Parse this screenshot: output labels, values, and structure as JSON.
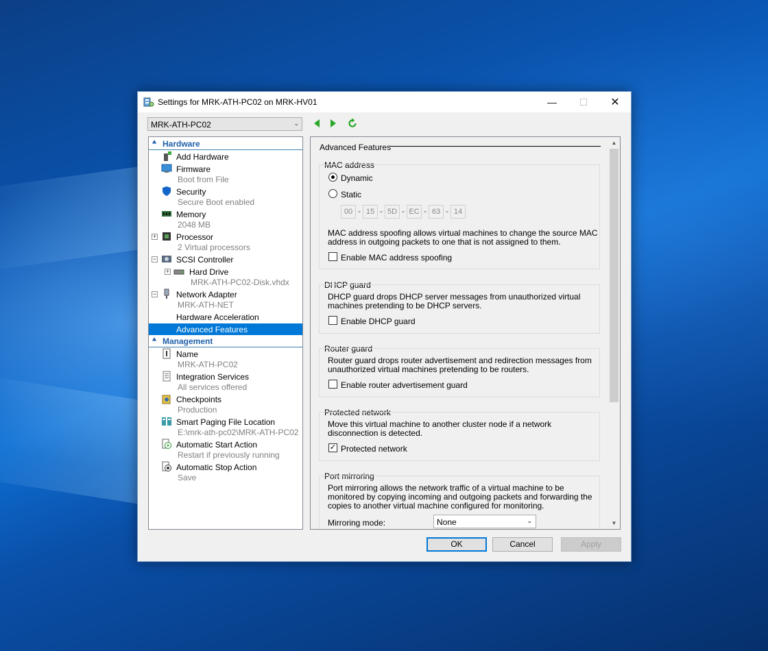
{
  "window": {
    "title": "Settings for MRK-ATH-PC02 on MRK-HV01",
    "controls": {
      "minimize": "—",
      "maximize": "☐",
      "close": "✕"
    }
  },
  "toolbar": {
    "vm_selector_value": "MRK-ATH-PC02",
    "icons": [
      "back-arrow-icon",
      "forward-arrow-icon",
      "refresh-icon"
    ]
  },
  "tree": {
    "hardware_header": "Hardware",
    "management_header": "Management",
    "hardware_items": [
      {
        "label": "Add Hardware",
        "sub": ""
      },
      {
        "label": "Firmware",
        "sub": "Boot from File"
      },
      {
        "label": "Security",
        "sub": "Secure Boot enabled"
      },
      {
        "label": "Memory",
        "sub": "2048 MB"
      },
      {
        "label": "Processor",
        "sub": "2 Virtual processors"
      },
      {
        "label": "SCSI Controller",
        "sub": ""
      },
      {
        "label": "Hard Drive",
        "sub": "MRK-ATH-PC02-Disk.vhdx"
      },
      {
        "label": "Network Adapter",
        "sub": "MRK-ATH-NET"
      },
      {
        "label": "Hardware Acceleration",
        "sub": ""
      },
      {
        "label": "Advanced Features",
        "sub": ""
      }
    ],
    "management_items": [
      {
        "label": "Name",
        "sub": "MRK-ATH-PC02"
      },
      {
        "label": "Integration Services",
        "sub": "All services offered"
      },
      {
        "label": "Checkpoints",
        "sub": "Production"
      },
      {
        "label": "Smart Paging File Location",
        "sub": "E:\\mrk-ath-pc02\\MRK-ATH-PC02"
      },
      {
        "label": "Automatic Start Action",
        "sub": "Restart if previously running"
      },
      {
        "label": "Automatic Stop Action",
        "sub": "Save"
      }
    ]
  },
  "panel": {
    "title": "Advanced Features",
    "mac": {
      "title": "MAC address",
      "dynamic_label": "Dynamic",
      "static_label": "Static",
      "selected": "Dynamic",
      "octets": [
        "00",
        "15",
        "5D",
        "EC",
        "63",
        "14"
      ],
      "separator": "-",
      "spoof_desc": "MAC address spoofing allows virtual machines to change the source MAC address in outgoing packets to one that is not assigned to them.",
      "spoof_label": "Enable MAC address spoofing",
      "spoof_checked": false
    },
    "dhcp": {
      "title": "DHCP guard",
      "desc": "DHCP guard drops DHCP server messages from unauthorized virtual machines pretending to be DHCP servers.",
      "label": "Enable DHCP guard",
      "checked": false
    },
    "router": {
      "title": "Router guard",
      "desc": "Router guard drops router advertisement and redirection messages from unauthorized virtual machines pretending to be routers.",
      "label": "Enable router advertisement guard",
      "checked": false
    },
    "protected": {
      "title": "Protected network",
      "desc": "Move this virtual machine to another cluster node if a network disconnection is detected.",
      "label": "Protected network",
      "checked": true,
      "check_glyph": "✓"
    },
    "mirroring": {
      "title": "Port mirroring",
      "desc": "Port mirroring allows the network traffic of a virtual machine to be monitored by copying incoming and outgoing packets and forwarding the copies to another virtual machine configured for monitoring.",
      "mode_label": "Mirroring mode:",
      "mode_value": "None"
    }
  },
  "buttons": {
    "ok": "OK",
    "cancel": "Cancel",
    "apply": "Apply"
  },
  "colors": {
    "selection": "#0078d7",
    "section_header": "#1e5fa8",
    "desktop": "#0a56b3"
  }
}
